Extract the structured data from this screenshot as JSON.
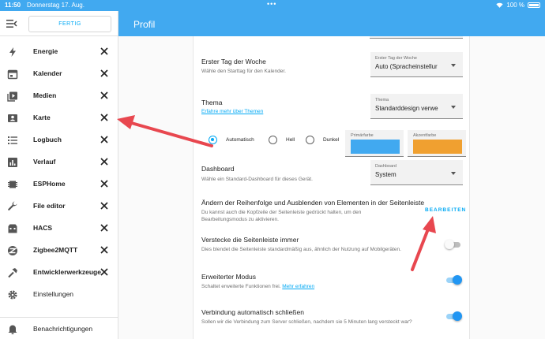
{
  "status_bar": {
    "time": "11:50",
    "date": "Donnerstag 17. Aug.",
    "battery": "100 %"
  },
  "sidebar": {
    "done_label": "FERTIG",
    "items": [
      {
        "label": "Energie",
        "icon": "lightning-icon"
      },
      {
        "label": "Kalender",
        "icon": "calendar-icon"
      },
      {
        "label": "Medien",
        "icon": "media-icon"
      },
      {
        "label": "Karte",
        "icon": "map-icon"
      },
      {
        "label": "Logbuch",
        "icon": "list-icon"
      },
      {
        "label": "Verlauf",
        "icon": "chart-icon"
      },
      {
        "label": "ESPHome",
        "icon": "esphome-icon"
      },
      {
        "label": "File editor",
        "icon": "wrench-icon"
      },
      {
        "label": "HACS",
        "icon": "hacs-icon"
      },
      {
        "label": "Zigbee2MQTT",
        "icon": "zigbee-icon"
      },
      {
        "label": "Entwicklerwerkzeuge",
        "icon": "hammer-icon"
      },
      {
        "label": "Einstellungen",
        "icon": "gear-icon"
      }
    ],
    "notifications": {
      "label": "Benachrichtigungen",
      "icon": "bell-icon"
    }
  },
  "header": {
    "title": "Profil"
  },
  "settings": {
    "first_day": {
      "title": "Erster Tag der Woche",
      "description": "Wähle den Starttag für den Kalender.",
      "field_label": "Erster Tag der Woche",
      "value": "Auto (Spracheinstellur"
    },
    "theme": {
      "title": "Thema",
      "link": "Erfahre mehr über Themen",
      "field_label": "Thema",
      "value": "Standarddesign verwe",
      "modes": [
        "Automatisch",
        "Hell",
        "Dunkel"
      ],
      "selected_mode": "Automatisch",
      "primary_label": "Primärfarbe",
      "accent_label": "Akzentfarbe",
      "primary_color": "#41a9f0",
      "accent_color": "#f0a030"
    },
    "dashboard": {
      "title": "Dashboard",
      "description": "Wähle ein Standard-Dashboard für dieses Gerät.",
      "field_label": "Dashboard",
      "value": "System"
    },
    "sidebar_order": {
      "title": "Ändern der Reihenfolge und Ausblenden von Elementen in der Seitenleiste",
      "description_1": "Du kannst auch die Kopfzeile der Seitenleiste gedrückt halten, um den",
      "description_2": "Bearbeitungsmodus zu aktivieren.",
      "button": "BEARBEITEN"
    },
    "hide_sidebar": {
      "title": "Verstecke die Seitenleiste immer",
      "description": "Dies blendet die Seitenleiste standardmäßig aus, ähnlich der Nutzung auf Mobilgeräten.",
      "enabled": false
    },
    "advanced_mode": {
      "title": "Erweiterter Modus",
      "description": "Schaltet erweiterte Funktionen frei.",
      "link": "Mehr erfahren",
      "enabled": true
    },
    "auto_close": {
      "title": "Verbindung automatisch schließen",
      "description": "Sollen wir die Verbindung zum Server schließen, nachdem sie 5 Minuten lang versteckt war?",
      "enabled": true
    }
  },
  "colors": {
    "accent": "#41a9f0",
    "arrow": "#e8474f"
  }
}
